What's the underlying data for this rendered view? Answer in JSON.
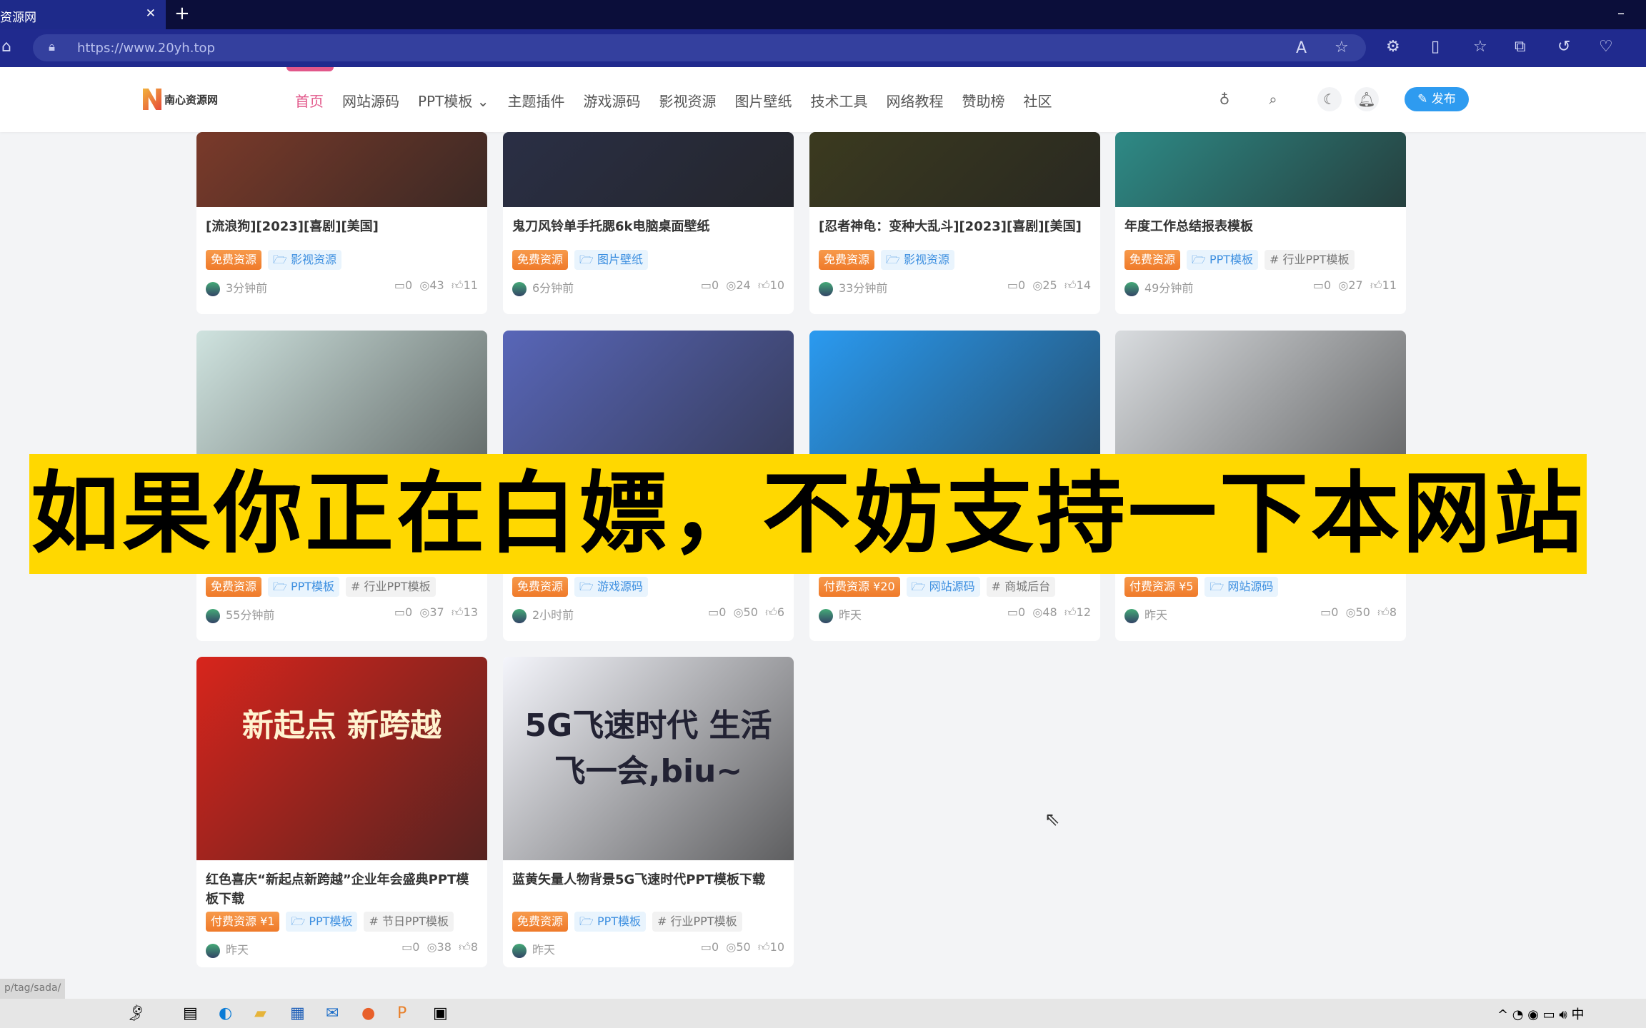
{
  "browser": {
    "tab_title": "资源网",
    "url": "https://www.20yh.top"
  },
  "header": {
    "logo_text": "南心资源网",
    "nav": [
      "首页",
      "网站源码",
      "PPT模板 ⌄",
      "主题插件",
      "游戏源码",
      "影视资源",
      "图片壁纸",
      "技术工具",
      "网络教程",
      "赞助榜",
      "社区"
    ],
    "publish_label": "✎ 发布"
  },
  "cards": [
    {
      "title": "[流浪狗][2023][喜剧][美国]",
      "tags": [
        {
          "type": "pay",
          "label": "免费资源"
        },
        {
          "type": "cat",
          "label": "🗁 影视资源"
        }
      ],
      "time": "3分钟前",
      "comments": "0",
      "views": "43",
      "likes": "11",
      "img": "#7a3a2a"
    },
    {
      "title": "鬼刀风铃单手托腮6k电脑桌面壁纸",
      "tags": [
        {
          "type": "pay",
          "label": "免费资源"
        },
        {
          "type": "cat",
          "label": "🗁 图片壁纸"
        }
      ],
      "time": "6分钟前",
      "comments": "0",
      "views": "24",
      "likes": "10",
      "img": "#2a2f45"
    },
    {
      "title": "[忍者神龟：变种大乱斗][2023][喜剧][美国]",
      "tags": [
        {
          "type": "pay",
          "label": "免费资源"
        },
        {
          "type": "cat",
          "label": "🗁 影视资源"
        }
      ],
      "time": "33分钟前",
      "comments": "0",
      "views": "25",
      "likes": "14",
      "img": "#3b3a1f"
    },
    {
      "title": "年度工作总结报表模板",
      "tags": [
        {
          "type": "pay",
          "label": "免费资源"
        },
        {
          "type": "cat",
          "label": "🗁 PPT模板"
        },
        {
          "type": "hash",
          "label": "# 行业PPT模板"
        }
      ],
      "time": "49分钟前",
      "comments": "0",
      "views": "27",
      "likes": "11",
      "img": "#2e8a86"
    },
    {
      "title": "",
      "tags": [
        {
          "type": "pay",
          "label": "免费资源"
        },
        {
          "type": "cat",
          "label": "🗁 PPT模板"
        },
        {
          "type": "hash",
          "label": "# 行业PPT模板"
        }
      ],
      "time": "55分钟前",
      "comments": "0",
      "views": "37",
      "likes": "13",
      "img": "#cfe3df"
    },
    {
      "title": "",
      "tags": [
        {
          "type": "pay",
          "label": "免费资源"
        },
        {
          "type": "cat",
          "label": "🗁 游戏源码"
        }
      ],
      "time": "2小时前",
      "comments": "0",
      "views": "50",
      "likes": "6",
      "img": "#5866b8"
    },
    {
      "title": "",
      "tags": [
        {
          "type": "pay",
          "label": "付费资源 ¥20"
        },
        {
          "type": "cat",
          "label": "🗁 网站源码"
        },
        {
          "type": "hash",
          "label": "# 商城后台"
        }
      ],
      "time": "昨天",
      "comments": "0",
      "views": "48",
      "likes": "12",
      "img": "#2a9af0"
    },
    {
      "title": "",
      "tags": [
        {
          "type": "pay",
          "label": "付费资源 ¥5"
        },
        {
          "type": "cat",
          "label": "🗁 网站源码"
        }
      ],
      "time": "昨天",
      "comments": "0",
      "views": "50",
      "likes": "8",
      "img": "#d9dcdf"
    },
    {
      "title": "红色喜庆“新起点新跨越”企业年会盛典PPT模板下载",
      "tags": [
        {
          "type": "pay",
          "label": "付费资源 ¥1"
        },
        {
          "type": "cat",
          "label": "🗁 PPT模板"
        },
        {
          "type": "hash",
          "label": "# 节日PPT模板"
        }
      ],
      "time": "昨天",
      "comments": "0",
      "views": "38",
      "likes": "8",
      "img": "#d8251c",
      "img_text": "新起点 新跨越"
    },
    {
      "title": "蓝黄矢量人物背景5G飞速时代PPT模板下载",
      "tags": [
        {
          "type": "pay",
          "label": "免费资源"
        },
        {
          "type": "cat",
          "label": "🗁 PPT模板"
        },
        {
          "type": "hash",
          "label": "# 行业PPT模板"
        }
      ],
      "time": "昨天",
      "comments": "0",
      "views": "50",
      "likes": "10",
      "img": "#f4f5fb",
      "img_text": "5G飞速时代 生活飞一会,biu~"
    }
  ],
  "banner": "如果你正在白嫖，不妨支持一下本网站",
  "status_url": "p/tag/sada/"
}
